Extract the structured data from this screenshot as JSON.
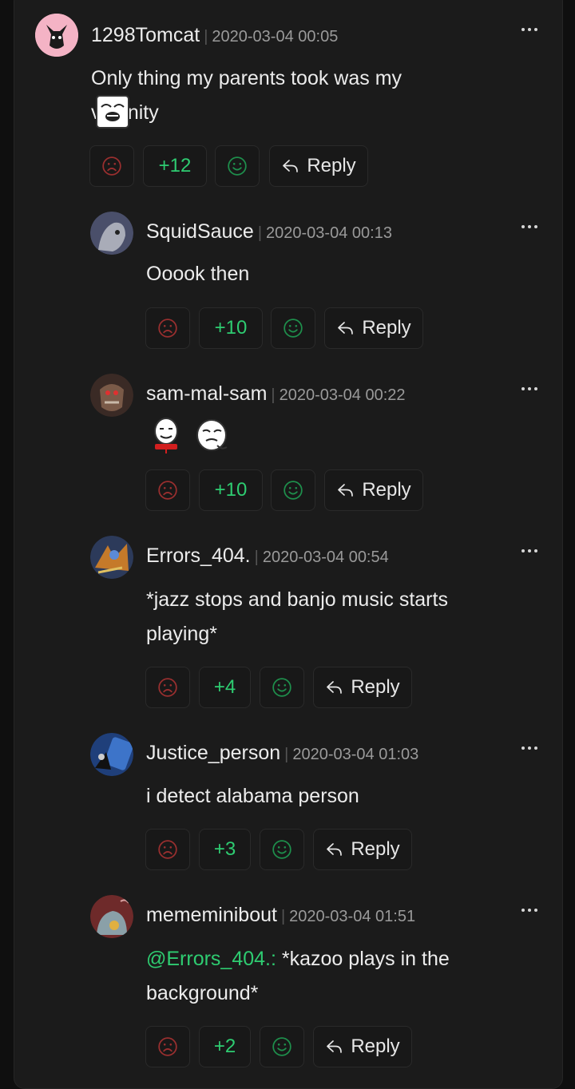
{
  "reply_label": "Reply",
  "separator": "|",
  "colors": {
    "score": "#2ecc71",
    "downvote": "#9a2f2f",
    "upvote": "#1e8f4c"
  },
  "comments": [
    {
      "user": "1298Tomcat",
      "date": "2020-03-04 00:05",
      "text": "Only thing my parents took was my virginity",
      "score": "+12",
      "emoji": [
        "sweet-jesus-rage-face"
      ]
    },
    {
      "user": "SquidSauce",
      "date": "2020-03-04 00:13",
      "text": "Ooook then",
      "score": "+10"
    },
    {
      "user": "sam-mal-sam",
      "date": "2020-03-04 00:22",
      "text": "",
      "score": "+10",
      "emoji": [
        "yaoming-face",
        "okay-face"
      ]
    },
    {
      "user": "Errors_404.",
      "date": "2020-03-04 00:54",
      "text": "*jazz stops and banjo music starts playing*",
      "score": "+4"
    },
    {
      "user": "Justice_person",
      "date": "2020-03-04 01:03",
      "text": "i detect alabama person",
      "score": "+3"
    },
    {
      "user": "mememinibout",
      "date": "2020-03-04 01:51",
      "mention": "@Errors_404.:",
      "text": " *kazoo plays in the background*",
      "score": "+2"
    }
  ]
}
